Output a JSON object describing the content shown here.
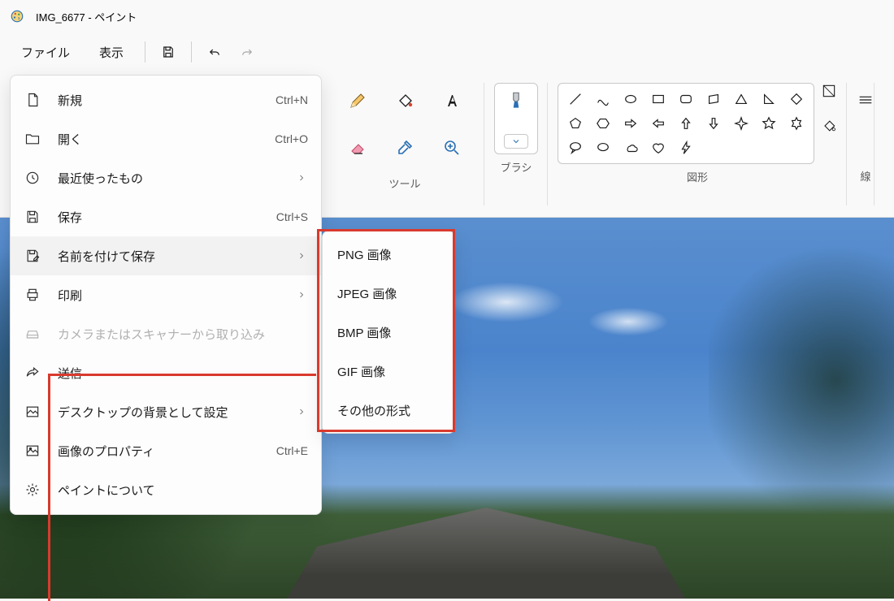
{
  "titlebar": {
    "title": "IMG_6677 - ペイント"
  },
  "menubar": {
    "file": "ファイル",
    "view": "表示"
  },
  "ribbon": {
    "tools_label": "ツール",
    "brush_label": "ブラシ",
    "shapes_label": "図形",
    "line_label": "線"
  },
  "file_menu": {
    "items": [
      {
        "label": "新規",
        "accel": "Ctrl+N",
        "chev": false
      },
      {
        "label": "開く",
        "accel": "Ctrl+O",
        "chev": false
      },
      {
        "label": "最近使ったもの",
        "accel": "",
        "chev": true
      },
      {
        "label": "保存",
        "accel": "Ctrl+S",
        "chev": false
      },
      {
        "label": "名前を付けて保存",
        "accel": "",
        "chev": true
      },
      {
        "label": "印刷",
        "accel": "",
        "chev": true
      },
      {
        "label": "カメラまたはスキャナーから取り込み",
        "accel": "",
        "chev": false
      },
      {
        "label": "送信",
        "accel": "",
        "chev": false
      },
      {
        "label": "デスクトップの背景として設定",
        "accel": "",
        "chev": true
      },
      {
        "label": "画像のプロパティ",
        "accel": "Ctrl+E",
        "chev": false
      },
      {
        "label": "ペイントについて",
        "accel": "",
        "chev": false
      }
    ]
  },
  "submenu": {
    "items": [
      {
        "label": "PNG 画像"
      },
      {
        "label": "JPEG 画像"
      },
      {
        "label": "BMP 画像"
      },
      {
        "label": "GIF 画像"
      },
      {
        "label": "その他の形式"
      }
    ]
  }
}
